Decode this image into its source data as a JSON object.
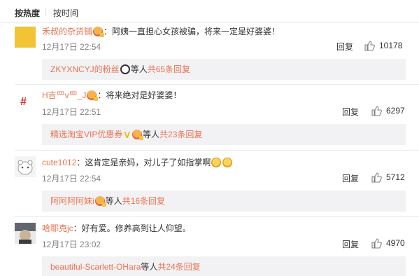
{
  "sort": {
    "hot": "按热度",
    "separator": "|",
    "time": "按时间"
  },
  "comments": [
    {
      "user": "禾叔的杂货铺",
      "text": "：阿姨一直担心女孩被骗，将来一定是好婆婆！",
      "time": "12月17日 22:54",
      "reply_label": "回复",
      "likes": "10178",
      "sub": {
        "user": "ZKYXNCYJ的粉丝",
        "deng": "等人",
        "total": "共65条回复"
      }
    },
    {
      "user": "H吉罒v罒_J",
      "text": "：将来绝对是好婆婆！",
      "time": "12月17日 22:51",
      "reply_label": "回复",
      "likes": "6297",
      "sub": {
        "user": "精选淘宝VIP优惠券",
        "deng": "等人",
        "total": "共23条回复"
      }
    },
    {
      "user": "cute1012",
      "text": "：这肯定是亲妈，对儿子了如指掌啊",
      "time": "12月17日 22:54",
      "reply_label": "回复",
      "likes": "5712",
      "sub": {
        "user": "阿阿阿阿妹i",
        "deng": "等人",
        "total": "共16条回复"
      }
    },
    {
      "user": "哈耶克jc",
      "text": "：好有爱。修养高到让人仰望。",
      "time": "12月17日 23:02",
      "reply_label": "回复",
      "likes": "4970",
      "sub": {
        "user": "beautiful-Scarlett-OHara",
        "deng": "等人",
        "total": "共24条回复"
      }
    }
  ],
  "colors": {
    "username": "#eb7350",
    "reply_box": "#f2f2f5",
    "time": "#808080",
    "divider": "#eaeaea"
  }
}
